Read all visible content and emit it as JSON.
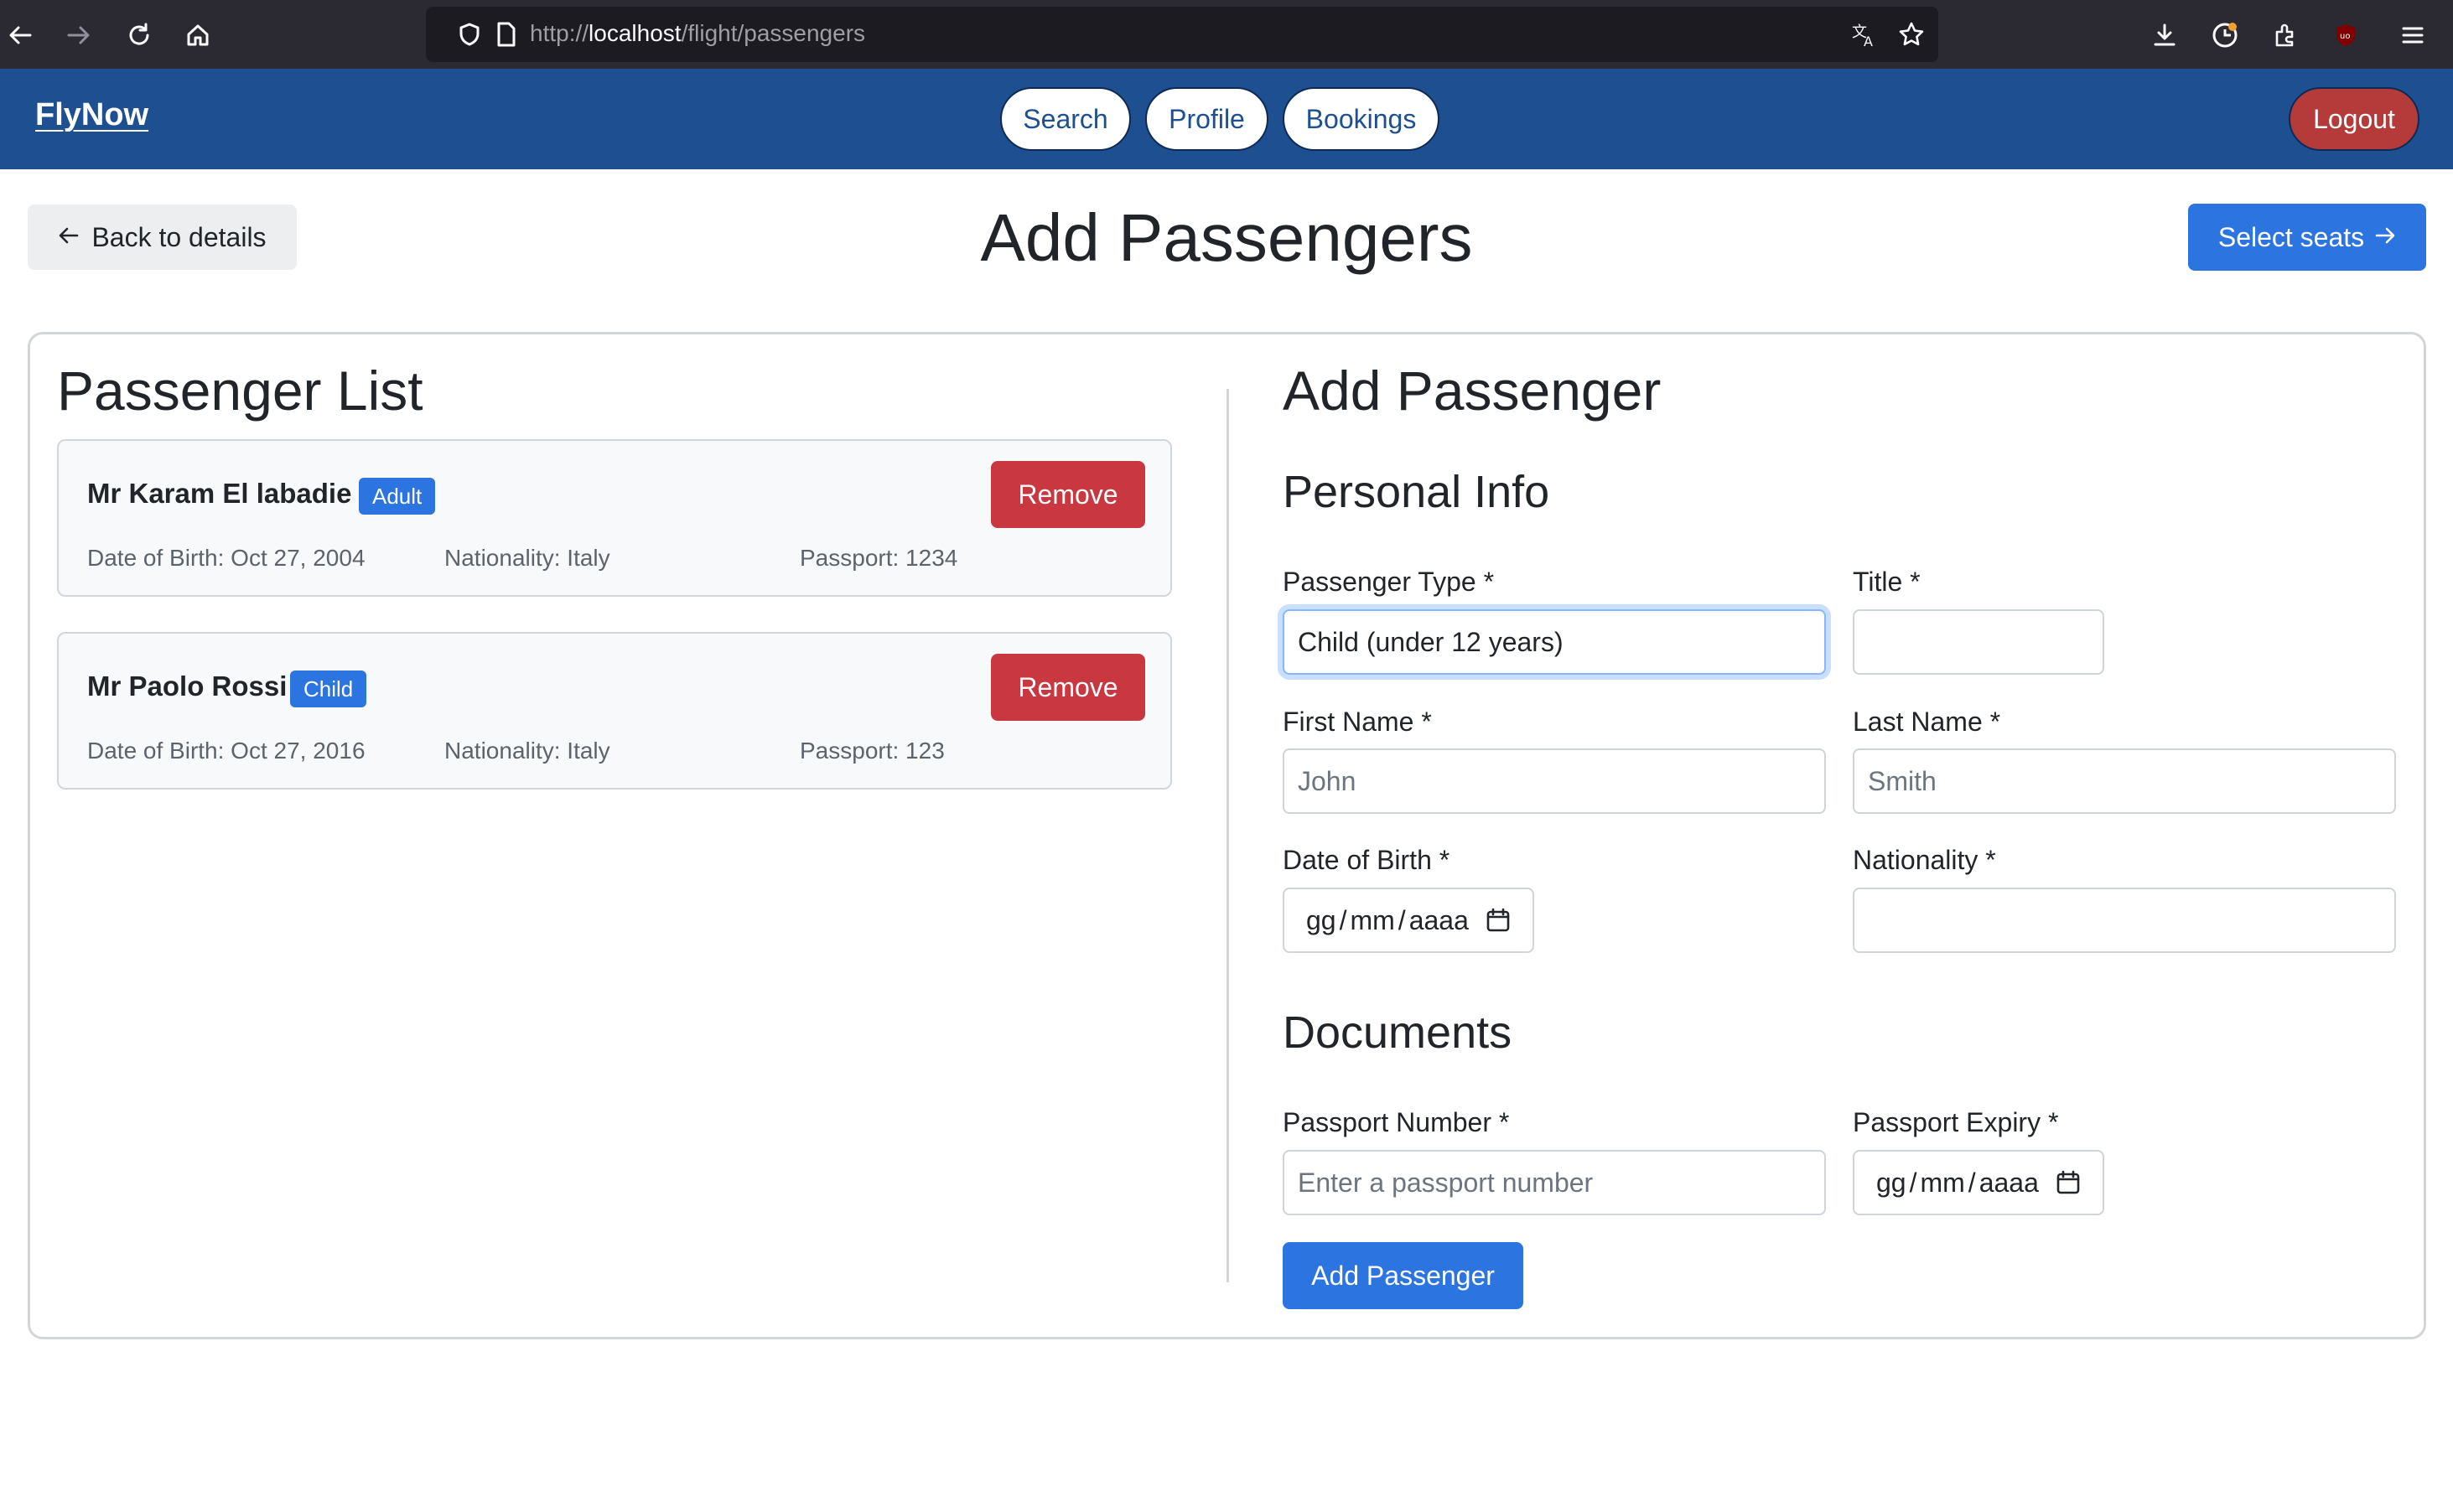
{
  "browser": {
    "url_scheme": "http://",
    "url_host": "localhost",
    "url_path": "/flight/passengers"
  },
  "navbar": {
    "brand": "FlyNow",
    "links": [
      "Search",
      "Profile",
      "Bookings"
    ],
    "logout": "Logout",
    "color": "#1e4f91"
  },
  "header": {
    "back_label": "Back to details",
    "title": "Add Passengers",
    "next_label": "Select seats"
  },
  "passenger_list": {
    "heading": "Passenger List",
    "remove_label": "Remove",
    "items": [
      {
        "name": "Mr Karam El labadie",
        "type": "Adult",
        "dob": "Date of Birth: Oct 27, 2004",
        "nationality": "Nationality: Italy",
        "passport": "Passport: 1234"
      },
      {
        "name": "Mr Paolo Rossi",
        "type": "Child",
        "dob": "Date of Birth: Oct 27, 2016",
        "nationality": "Nationality: Italy",
        "passport": "Passport: 123"
      }
    ]
  },
  "form": {
    "heading": "Add Passenger",
    "personal_heading": "Personal Info",
    "documents_heading": "Documents",
    "passenger_type": {
      "label": "Passenger Type *",
      "value": "Child (under 12 years)"
    },
    "title": {
      "label": "Title *",
      "value": ""
    },
    "first_name": {
      "label": "First Name *",
      "placeholder": "John"
    },
    "last_name": {
      "label": "Last Name *",
      "placeholder": "Smith"
    },
    "dob": {
      "label": "Date of Birth *",
      "dd": "gg",
      "mm": "mm",
      "yyyy": "aaaa"
    },
    "nationality": {
      "label": "Nationality *",
      "value": ""
    },
    "passport_number": {
      "label": "Passport Number *",
      "placeholder": "Enter a passport number"
    },
    "passport_expiry": {
      "label": "Passport Expiry *",
      "dd": "gg",
      "mm": "mm",
      "yyyy": "aaaa"
    },
    "submit_label": "Add Passenger"
  }
}
